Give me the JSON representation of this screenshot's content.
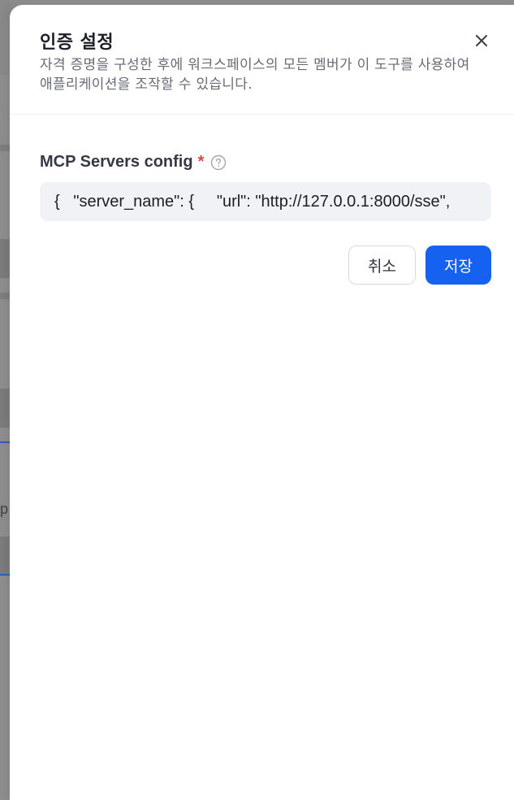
{
  "drawer": {
    "title": "인증 설정",
    "subtitle": "자격 증명을 구성한 후에 워크스페이스의 모든 멤버가 이 도구를 사용하여 애플리케이션을 조작할 수 있습니다.",
    "close_icon": "close-icon"
  },
  "form": {
    "field_label": "MCP Servers config",
    "required_mark": "*",
    "help_icon": "question-circle-icon",
    "config_value": "{   \"server_name\": {     \"url\": \"http://127.0.0.1:8000/sse\","
  },
  "actions": {
    "cancel_label": "취소",
    "save_label": "저장"
  },
  "background": {
    "partial_letter": "p"
  },
  "colors": {
    "primary": "#1562f0",
    "required": "#e0443e",
    "input_bg": "#f1f2f5"
  }
}
